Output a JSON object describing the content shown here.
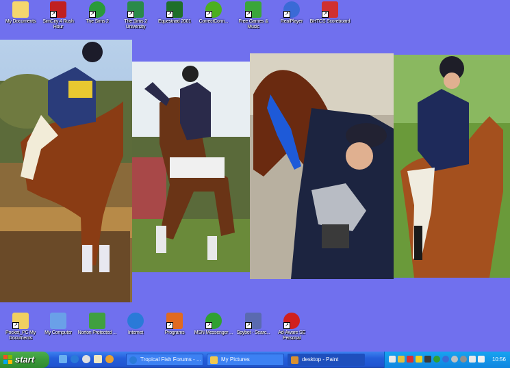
{
  "desktop": {
    "top_icons": [
      {
        "label": "My Documents",
        "icon": "folder-documents-icon",
        "color": "#f5d76e"
      },
      {
        "label": "SimCity 4 Rush Hour",
        "icon": "simcity-icon",
        "color": "#c02020"
      },
      {
        "label": "The Sims 2",
        "icon": "sims2-icon",
        "color": "#2a9a3a"
      },
      {
        "label": "The Sims 2 University",
        "icon": "sims2-university-icon",
        "color": "#2a8a4a"
      },
      {
        "label": "Equestriad 2001",
        "icon": "equestriad-icon",
        "color": "#1f6f2a"
      },
      {
        "label": "CorrectConn...",
        "icon": "correctconnect-icon",
        "color": "#4caf20"
      },
      {
        "label": "Free Games & Music",
        "icon": "free-games-icon",
        "color": "#3aa63a"
      },
      {
        "label": "RealPlayer",
        "icon": "realplayer-icon",
        "color": "#3a6ad6"
      },
      {
        "label": "BHTCS Scoreboard",
        "icon": "scoreboard-icon",
        "color": "#d03030"
      }
    ],
    "bottom_icons": [
      {
        "label": "Pocket_PC My Documents",
        "icon": "pocketpc-folder-icon",
        "color": "#f0d060"
      },
      {
        "label": "My Computer",
        "icon": "my-computer-icon",
        "color": "#6aa0e8"
      },
      {
        "label": "Norton Protected ...",
        "icon": "norton-recycle-icon",
        "color": "#40a040"
      },
      {
        "label": "Internet",
        "icon": "internet-explorer-icon",
        "color": "#2a7ad8"
      },
      {
        "label": "Programs",
        "icon": "programs-icon",
        "color": "#e06a20"
      },
      {
        "label": "MSN Messenger ...",
        "icon": "msn-messenger-icon",
        "color": "#30a030"
      },
      {
        "label": "Spybot - Searc...",
        "icon": "spybot-icon",
        "color": "#5a6ab0"
      },
      {
        "label": "Ad-Aware SE Personal",
        "icon": "adaware-icon",
        "color": "#d02020"
      }
    ],
    "background_color": "#7070ee"
  },
  "taskbar": {
    "start_label": "start",
    "tasks": [
      {
        "label": "Tropical Fish Forums - ...",
        "icon": "ie-window-icon",
        "color": "#2a7ad8",
        "active": false
      },
      {
        "label": "My Pictures",
        "icon": "folder-window-icon",
        "color": "#f0c850",
        "active": false
      },
      {
        "label": "desktop - Paint",
        "icon": "paint-icon",
        "color": "#d89030",
        "active": true
      }
    ],
    "clock": "10:56"
  }
}
